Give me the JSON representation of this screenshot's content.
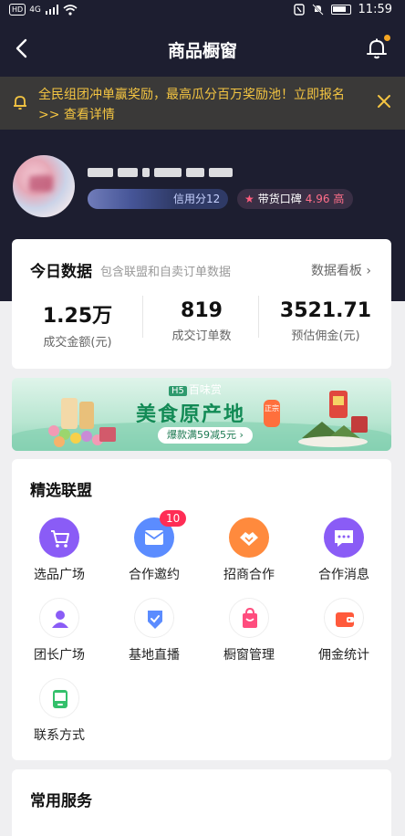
{
  "status_bar": {
    "left": "HD",
    "net": "4G",
    "time": "11:59"
  },
  "nav": {
    "title": "商品橱窗"
  },
  "notice": {
    "text": "全民组团冲单赢奖励，最高瓜分百万奖励池！立即报名 >> 查看详情"
  },
  "profile": {
    "score_label": "信用分12",
    "reputation_label": "带货口碑",
    "reputation_value": "4.96 高"
  },
  "today": {
    "title": "今日数据",
    "subtitle": "包含联盟和自卖订单数据",
    "link": "数据看板 ›",
    "stats": [
      {
        "value": "1.25万",
        "label": "成交金额(元)"
      },
      {
        "value": "819",
        "label": "成交订单数"
      },
      {
        "value": "3521.71",
        "label": "预估佣金(元)"
      }
    ]
  },
  "promo": {
    "badge_logo": "H5",
    "badge_text": "百味赏",
    "title": "美食原产地",
    "tag": "正宗",
    "pill": "爆款满59减5元 ›"
  },
  "union": {
    "title": "精选联盟",
    "items": [
      {
        "label": "选品广场",
        "icon": "cart-icon",
        "color": "#8a5cf6"
      },
      {
        "label": "合作邀约",
        "icon": "mail-icon",
        "color": "#5b8cff",
        "badge": "10"
      },
      {
        "label": "招商合作",
        "icon": "handshake-icon",
        "color": "#ff8a3d"
      },
      {
        "label": "合作消息",
        "icon": "message-icon",
        "color": "#8a5cf6"
      },
      {
        "label": "团长广场",
        "icon": "person-icon",
        "color": "#8a5cf6"
      },
      {
        "label": "基地直播",
        "icon": "shield-check-icon",
        "color": "#5b8cff"
      },
      {
        "label": "橱窗管理",
        "icon": "bag-icon",
        "color": "#ff4d7e"
      },
      {
        "label": "佣金统计",
        "icon": "wallet-icon",
        "color": "#ff5a3c"
      },
      {
        "label": "联系方式",
        "icon": "phone-icon",
        "color": "#33c06b"
      }
    ]
  },
  "service": {
    "title": "常用服务"
  }
}
